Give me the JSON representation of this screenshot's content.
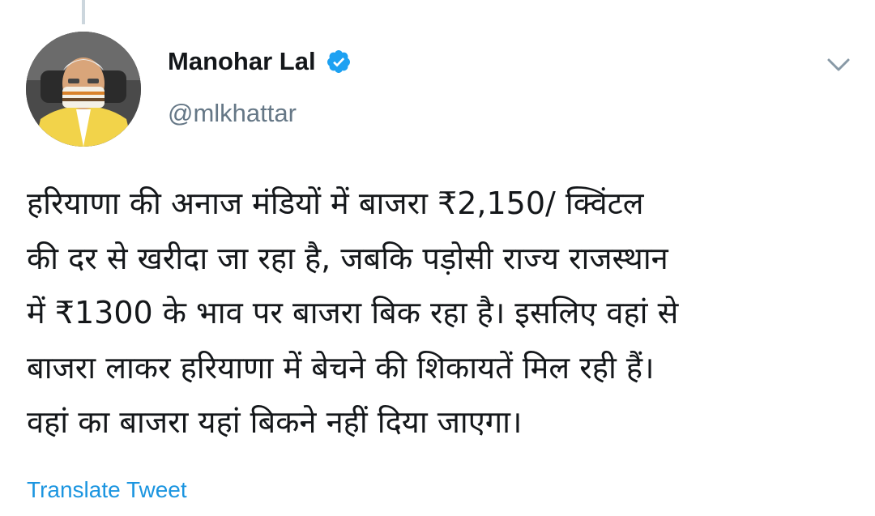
{
  "author": {
    "display_name": "Manohar Lal",
    "handle": "@mlkhattar",
    "verified": true,
    "avatar_icon": "profile-photo"
  },
  "tweet": {
    "lines": [
      "हरियाणा की अनाज मंडियों में बाजरा ₹2,150/ क्विंटल",
      "की दर से खरीदा जा रहा है, जबकि पड़ोसी राज्य राजस्थान",
      "में ₹1300 के भाव पर बाजरा बिक रहा है। इसलिए वहां से",
      "बाजरा लाकर हरियाणा में बेचने की शिकायतें मिल रही हैं।",
      "वहां का बाजरा यहां बिकने नहीं दिया जाएगा।"
    ]
  },
  "actions": {
    "translate_label": "Translate Tweet",
    "more_icon": "chevron-down-icon"
  },
  "colors": {
    "accent": "#1b95e0",
    "secondary_text": "#657786",
    "verified_badge": "#1da1f2",
    "thread_line": "#ccd6dd"
  }
}
